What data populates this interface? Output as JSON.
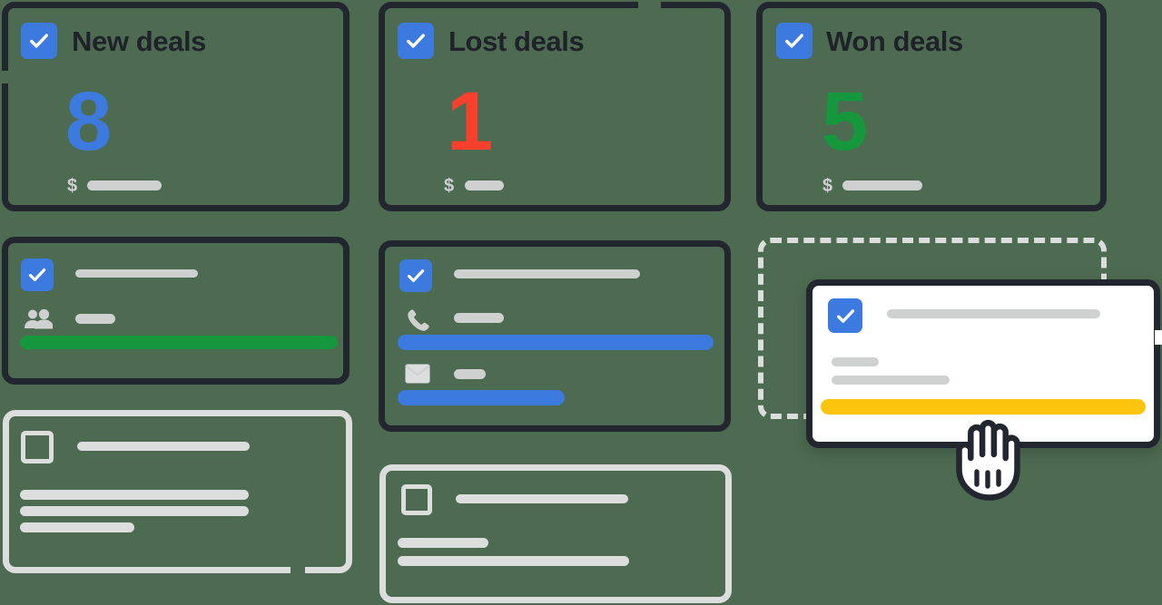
{
  "page": {
    "background_color": "#4d6b51",
    "title": "Deals board drag and drop"
  },
  "palette": {
    "card_border": "#22262e",
    "card_border_light": "#dcdedd",
    "checkbox_blue": "#3d7ae0",
    "bar_gray": "#cfd1d0",
    "bar_green": "#14973d",
    "bar_blue": "#3d7ae0",
    "bar_yellow": "#fcc50d",
    "metric_blue": "#3d7ae0",
    "metric_red": "#f9402d",
    "metric_green": "#14973d",
    "text_dark": "#1f2329",
    "card_white": "#ffffff"
  },
  "stats": {
    "cards": [
      {
        "id": "new-deals",
        "label": "New deals",
        "value": "8",
        "value_color": "#3d7ae0",
        "currency_symbol": "$",
        "amount_placeholder_width": 95,
        "checkbox_checked": true
      },
      {
        "id": "lost-deals",
        "label": "Lost deals",
        "value": "1",
        "value_color": "#f9402d",
        "currency_symbol": "$",
        "amount_placeholder_width": 49,
        "checkbox_checked": true
      },
      {
        "id": "won-deals",
        "label": "Won deals",
        "value": "5",
        "value_color": "#14973d",
        "currency_symbol": "$",
        "amount_placeholder_width": 90,
        "checkbox_checked": true
      }
    ]
  },
  "deal_cards": [
    {
      "id": "deal-card-green",
      "checkbox_checked": true,
      "icons": [
        "check-icon",
        "people-icon"
      ],
      "progress_color": "#14973d",
      "placeholder_rows": 2
    },
    {
      "id": "deal-card-contact",
      "checkbox_checked": true,
      "icons": [
        "check-icon",
        "phone-icon",
        "mail-icon"
      ],
      "progress_color": "#3d7ae0",
      "placeholder_rows": 3
    },
    {
      "id": "deal-card-dragged",
      "checkbox_checked": true,
      "icons": [
        "check-icon"
      ],
      "progress_color": "#fcc50d",
      "placeholder_rows": 3,
      "state": "dragging"
    },
    {
      "id": "deal-card-draft-left",
      "checkbox_checked": false,
      "icons": [
        "empty-checkbox-icon"
      ],
      "placeholder_rows": 4
    },
    {
      "id": "deal-card-draft-middle",
      "checkbox_checked": false,
      "icons": [
        "empty-checkbox-icon"
      ],
      "placeholder_rows": 3
    }
  ],
  "dropzone": {
    "id": "dropzone-won",
    "style": "dashed",
    "border_color": "#dcdedd",
    "label": ""
  },
  "cursor": {
    "id": "grab-hand-cursor",
    "kind": "grab-hand",
    "fill": "#ffffff",
    "stroke": "#22262e"
  }
}
